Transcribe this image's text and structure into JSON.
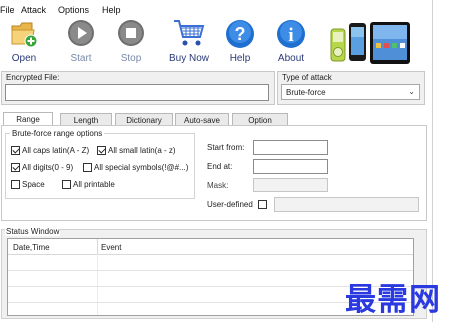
{
  "menu": {
    "file": "File",
    "attack": "Attack",
    "options": "Options",
    "help": "Help"
  },
  "toolbar": {
    "open": "Open",
    "start": "Start",
    "stop": "Stop",
    "buy_now": "Buy Now",
    "help": "Help",
    "about": "About"
  },
  "encrypted_file": {
    "label": "Encrypted File:",
    "value": ""
  },
  "type_of_attack": {
    "label": "Type of attack",
    "selected": "Brute-force"
  },
  "tabs": [
    "Range",
    "Length",
    "Dictionary",
    "Auto-save",
    "Option"
  ],
  "range": {
    "group_label": "Brute-force range options",
    "options": [
      {
        "label": "All caps latin(A - Z)",
        "checked": true
      },
      {
        "label": "All small latin(a - z)",
        "checked": true
      },
      {
        "label": "All digits(0 - 9)",
        "checked": true
      },
      {
        "label": "All special symbols(!@#...)",
        "checked": false
      },
      {
        "label": "Space",
        "checked": false
      },
      {
        "label": "All printable",
        "checked": false
      }
    ],
    "start_from": {
      "label": "Start from:",
      "value": ""
    },
    "end_at": {
      "label": "End at:",
      "value": ""
    },
    "mask": {
      "label": "Mask:",
      "value": ""
    },
    "user_defined": {
      "label": "User-defined",
      "checked": false,
      "value": ""
    }
  },
  "status_window": {
    "label": "Status Window",
    "columns": [
      "Date,Time",
      "Event"
    ]
  },
  "watermark": "最需网",
  "colors": {
    "accent_blue": "#1f6fd0",
    "watermark": "#2a3ae0",
    "panel_bg": "#f0f0f0"
  }
}
